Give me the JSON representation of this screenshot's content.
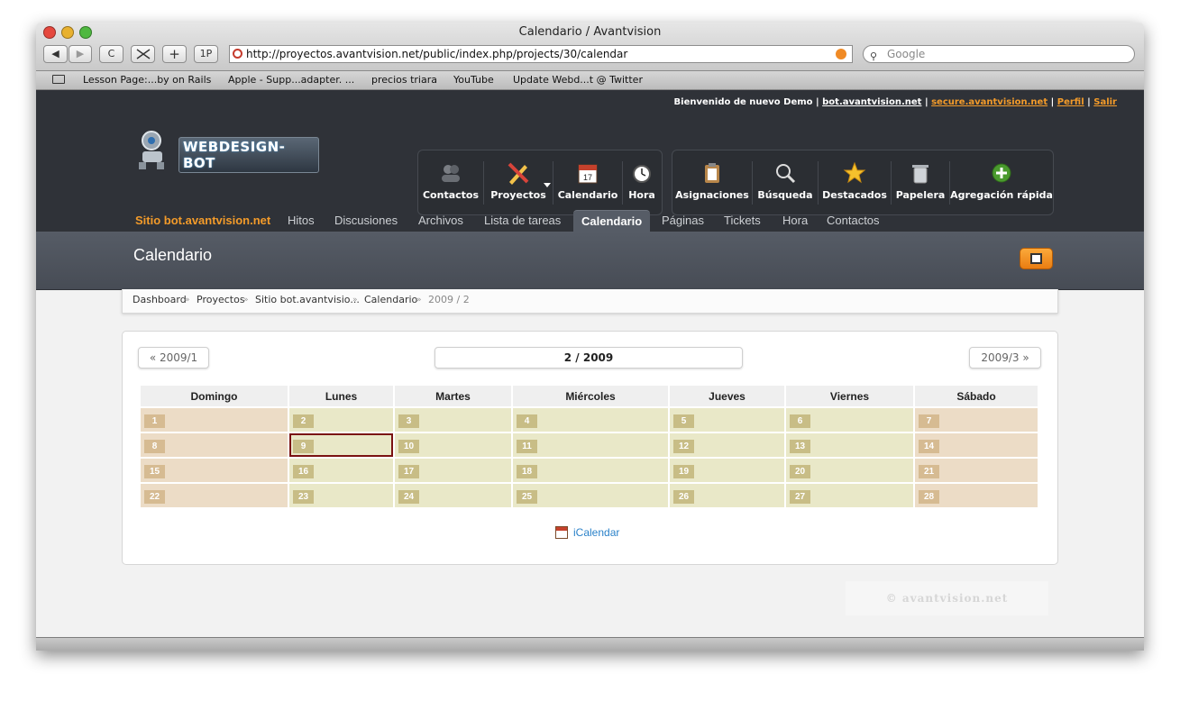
{
  "browser": {
    "title": "Calendario / Avantvision",
    "url": "http://proyectos.avantvision.net/public/index.php/projects/30/calendar",
    "search_placeholder": "Google",
    "back_label": "◀",
    "forward_label": "▶",
    "reload_label": "C",
    "add_label": "+",
    "onepass_label": "1P",
    "bookmarks": [
      "Lesson Page:...by on Rails",
      "Apple - Supp...adapter. ...",
      "precios triara",
      "YouTube",
      "Update Webd...t @ Twitter"
    ]
  },
  "header": {
    "welcome_text": "Bienvenido de nuevo Demo",
    "link1": "bot.avantvision.net",
    "link2": "secure.avantvision.net",
    "link3": "Perfil",
    "link4": "Salir",
    "sep": "|",
    "logo_text": "WEBDESIGN-BOT"
  },
  "toolbar": {
    "group1": [
      "Contactos",
      "Proyectos",
      "Calendario",
      "Hora"
    ],
    "group2": [
      "Asignaciones",
      "Búsqueda",
      "Destacados",
      "Papelera",
      "Agregación rápida"
    ],
    "calendar_day": "17"
  },
  "tabs": {
    "site": "Sitio bot.avantvision.net",
    "items": [
      "Hitos",
      "Discusiones",
      "Archivos",
      "Lista de tareas",
      "Calendario",
      "Páginas",
      "Tickets",
      "Hora",
      "Contactos"
    ]
  },
  "page": {
    "title": "Calendario"
  },
  "breadcrumb": {
    "items": [
      "Dashboard",
      "Proyectos",
      "Sitio bot.avantvisio...",
      "Calendario"
    ],
    "current": "2009 / 2",
    "sep": "»"
  },
  "calendar": {
    "prev": "« 2009/1",
    "next": "2009/3 »",
    "month_label": "2 / 2009",
    "weekdays": [
      "Domingo",
      "Lunes",
      "Martes",
      "Miércoles",
      "Jueves",
      "Viernes",
      "Sábado"
    ],
    "weeks": [
      [
        "1",
        "2",
        "3",
        "4",
        "5",
        "6",
        "7"
      ],
      [
        "8",
        "9",
        "10",
        "11",
        "12",
        "13",
        "14"
      ],
      [
        "15",
        "16",
        "17",
        "18",
        "19",
        "20",
        "21"
      ],
      [
        "22",
        "23",
        "24",
        "25",
        "26",
        "27",
        "28"
      ]
    ],
    "today": "9",
    "ical_label": "iCalendar"
  },
  "footer": {
    "text": "© avantvision.net"
  },
  "colors": {
    "accent": "#f39b2a",
    "header_bg": "#2f3238",
    "weekend_cell": "#ecdcc6",
    "weekday_cell": "#e9e8c8",
    "today_border": "#7a1212"
  },
  "icons": [
    "search-icon",
    "contacts-icon",
    "projects-icon",
    "calendar-icon",
    "clock-icon",
    "clipboard-icon",
    "magnifier-icon",
    "star-icon",
    "trash-icon",
    "add-icon",
    "print-icon"
  ]
}
